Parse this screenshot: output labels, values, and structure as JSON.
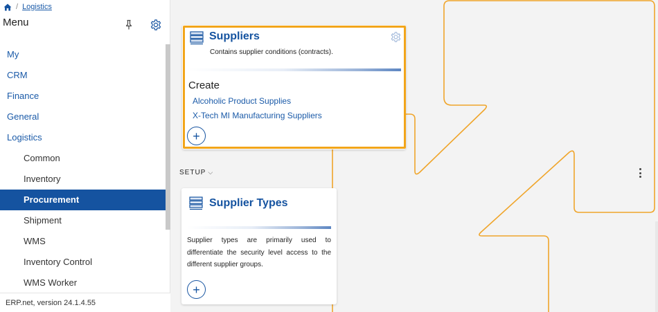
{
  "breadcrumb": {
    "separator": "/",
    "current": "Logistics",
    "home_icon": "home-icon"
  },
  "menu": {
    "title": "Menu",
    "pin_icon": "pin-icon",
    "settings_icon": "gear-icon",
    "items": [
      {
        "label": "My",
        "level": 0
      },
      {
        "label": "CRM",
        "level": 0
      },
      {
        "label": "Finance",
        "level": 0
      },
      {
        "label": "General",
        "level": 0
      },
      {
        "label": "Logistics",
        "level": 0
      },
      {
        "label": "Common",
        "level": 1
      },
      {
        "label": "Inventory",
        "level": 1
      },
      {
        "label": "Procurement",
        "level": 1,
        "active": true
      },
      {
        "label": "Shipment",
        "level": 1
      },
      {
        "label": "WMS",
        "level": 1
      },
      {
        "label": "Inventory Control",
        "level": 1
      },
      {
        "label": "WMS Worker",
        "level": 1
      }
    ],
    "version": "ERP.net, version 24.1.4.55"
  },
  "suppliers_card": {
    "title": "Suppliers",
    "description": "Contains supplier conditions (contracts).",
    "create_label": "Create",
    "links": [
      "Alcoholic Product Supplies",
      "X-Tech MI Manufacturing Suppliers"
    ],
    "add_symbol": "+",
    "icon": "stack-icon",
    "settings_icon": "gear-icon"
  },
  "setup_section": {
    "label": "SETUP",
    "chevron": "⌵"
  },
  "supplier_types_card": {
    "title": "Supplier Types",
    "description": "Supplier types are primarily used to differentiate the security level access to the different supplier groups.",
    "add_symbol": "+",
    "icon": "stack-icon"
  },
  "colors": {
    "accent": "#1553a0",
    "highlight": "#f2a51a",
    "link": "#1a5aa8"
  }
}
